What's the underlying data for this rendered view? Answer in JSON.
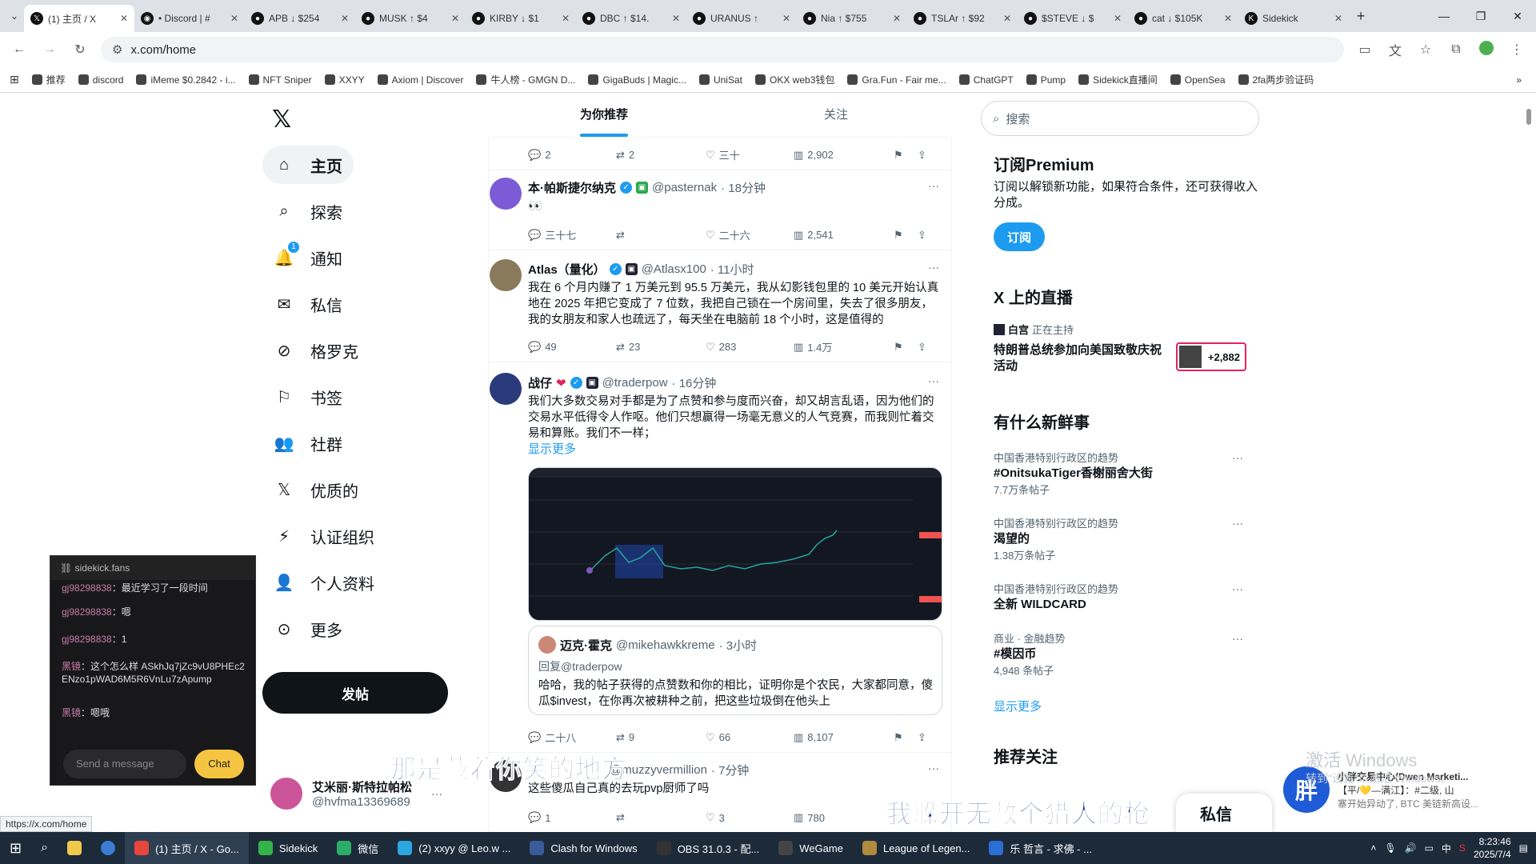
{
  "browser": {
    "tabs": [
      {
        "icon": "x-icon",
        "label": "(1) 主页 / X",
        "active": true
      },
      {
        "icon": "discord-icon",
        "label": "• Discord | #"
      },
      {
        "icon": "token-icon",
        "label": "APB ↓ $254"
      },
      {
        "icon": "token-icon",
        "label": "MUSK ↑ $4"
      },
      {
        "icon": "token-icon",
        "label": "KIRBY ↓ $1"
      },
      {
        "icon": "token-icon",
        "label": "DBC ↑ $14."
      },
      {
        "icon": "token-icon",
        "label": "URANUS ↑"
      },
      {
        "icon": "token-icon",
        "label": "Nia ↑ $755"
      },
      {
        "icon": "token-icon",
        "label": "TSLAr ↑ $92"
      },
      {
        "icon": "token-icon",
        "label": "$STEVE ↓ $"
      },
      {
        "icon": "token-icon",
        "label": "cat ↓ $105K"
      },
      {
        "icon": "sidekick-icon",
        "label": "Sidekick"
      }
    ],
    "url": "x.com/home",
    "bookmarks": [
      "推荐",
      "discord",
      "iMeme $0.2842 - i...",
      "NFT Sniper",
      "XXYY",
      "Axiom | Discover",
      "牛人榜 - GMGN D...",
      "GigaBuds | Magic...",
      "UniSat",
      "OKX web3钱包",
      "Gra.Fun - Fair me...",
      "ChatGPT",
      "Pump",
      "Sidekick直播间",
      "OpenSea",
      "2fa两步验证码"
    ],
    "status_url": "https://x.com/home"
  },
  "nav": {
    "items": [
      {
        "label": "主页",
        "icon": "home-icon"
      },
      {
        "label": "探索",
        "icon": "search-icon"
      },
      {
        "label": "通知",
        "icon": "bell-icon"
      },
      {
        "label": "私信",
        "icon": "mail-icon"
      },
      {
        "label": "格罗克",
        "icon": "grok-icon"
      },
      {
        "label": "书签",
        "icon": "bookmark-icon"
      },
      {
        "label": "社群",
        "icon": "community-icon"
      },
      {
        "label": "优质的",
        "icon": "x-icon"
      },
      {
        "label": "认证组织",
        "icon": "lightning-icon"
      },
      {
        "label": "个人资料",
        "icon": "person-icon"
      },
      {
        "label": "更多",
        "icon": "more-circle-icon"
      }
    ],
    "notif_count": "1",
    "post_label": "发帖",
    "profile_name": "艾米丽·斯特拉帕松",
    "profile_handle": "@hvfma13369689"
  },
  "feed": {
    "tab_for_you": "为你推荐",
    "tab_following": "关注",
    "top_actions": {
      "reply": "2",
      "retweet": "2",
      "like": "三十",
      "views": "2,902"
    },
    "tweets": [
      {
        "name": "本·帕斯捷尔纳克",
        "handle": "@pasternak",
        "time": "· 18分钟",
        "text": "👀",
        "reply": "三十七",
        "retweet": "",
        "like": "二十六",
        "views": "2,541"
      },
      {
        "name": "Atlas（量化）",
        "handle": "@Atlasx100",
        "time": "· 11小时",
        "text": "我在 6 个月内赚了 1 万美元到 95.5 万美元，我从幻影钱包里的 10 美元开始认真地在 2025 年把它变成了 7 位数，我把自己锁在一个房间里，失去了很多朋友，我的女朋友和家人也疏远了，每天坐在电脑前 18 个小时，这是值得的",
        "reply": "49",
        "retweet": "23",
        "like": "283",
        "views": "1.4万"
      },
      {
        "name": "战仔",
        "handle": "@traderpow",
        "time": "· 16分钟",
        "text": "我们大多数交易对手都是为了点赞和参与度而兴奋，却又胡言乱语，因为他们的交易水平低得令人作呕。他们只想赢得一场毫无意义的人气竞赛，而我则忙着交易和算账。我们不一样；",
        "show_more": "显示更多",
        "quote_name": "迈克·霍克",
        "quote_handle": "@mikehawkkreme",
        "quote_time": "· 3小时",
        "quote_reply_to": "回复@traderpow",
        "quote_text": "哈哈，我的帖子获得的点赞数和你的相比，证明你是个农民，大家都同意，傻瓜$invest，在你再次被耕种之前，把这些垃圾倒在他头上",
        "reply": "二十八",
        "retweet": "9",
        "like": "66",
        "views": "8,107"
      },
      {
        "name": "",
        "handle": "@muzzyvermillion",
        "time": "· 7分钟",
        "text": "这些傻瓜自己真的去玩pvp厨师了吗",
        "reply": "1",
        "retweet": "",
        "like": "3",
        "views": "780"
      }
    ]
  },
  "right": {
    "search_placeholder": "搜索",
    "premium_title": "订阅Premium",
    "premium_text": "订阅以解锁新功能，如果符合条件，还可获得收入分成。",
    "premium_btn": "订阅",
    "spaces_title": "X 上的直播",
    "space_host": "白宫",
    "space_status": "正在主持",
    "space_title": "特朗普总统参加向美国致敬庆祝活动",
    "space_count": "+2,882",
    "trends_title": "有什么新鲜事",
    "trends": [
      {
        "cat": "中国香港特别行政区的趋势",
        "name": "#OnitsukaTiger香榭丽舍大街",
        "count": "7.7万条帖子"
      },
      {
        "cat": "中国香港特别行政区的趋势",
        "name": "渴望的",
        "count": "1.38万条帖子"
      },
      {
        "cat": "中国香港特别行政区的趋势",
        "name": "全新 WILDCARD",
        "count": ""
      },
      {
        "cat": "商业 · 金融趋势",
        "name": "#模因币",
        "count": "4,948 条帖子"
      }
    ],
    "show_more": "显示更多",
    "follow_title": "推荐关注",
    "dm_label": "私信"
  },
  "sidekick": {
    "title": "sidekick.fans",
    "messages": [
      {
        "user": "gj98298838",
        "text": "：最近学习了一段时间"
      },
      {
        "user": "gj98298838",
        "text": "：嗯"
      },
      {
        "user": "gj98298838",
        "text": "：1"
      },
      {
        "user": "黑镜",
        "text": "：这个怎么样 ASkhJq7jZc9vU8PHEc2ENzo1pWAD6M5R6VnLu7zApump"
      },
      {
        "user": "黑镜",
        "text": "：嗯哦"
      }
    ],
    "input_placeholder": "Send a message",
    "chat_btn": "Chat"
  },
  "subtitles": {
    "line1": "那是藏着你笑的地方",
    "line2": "我躲开无数个猎人的枪"
  },
  "overlay": {
    "watermark_title": "激活 Windows",
    "watermark_sub": "转到\"设置\"以激活 Windows。",
    "notif_badge": "胖",
    "notif_title": "小胖交易中心(Dwen Marketi...",
    "notif_line1": "【平/💛—满江】：#二级, 山",
    "notif_line2": "寨开始异动了, BTC 美链新高设..."
  },
  "taskbar": {
    "apps": [
      {
        "label": "(1) 主页 / X - Go...",
        "color": "#e8453c",
        "active": true
      },
      {
        "label": "Sidekick",
        "color": "#35b34a"
      },
      {
        "label": "微信",
        "color": "#2aae67"
      },
      {
        "label": "(2) xxyy @ Leo.w ...",
        "color": "#2ca5e0"
      },
      {
        "label": "Clash for Windows",
        "color": "#3a5a9a"
      },
      {
        "label": "OBS 31.0.3 - 配...",
        "color": "#333"
      },
      {
        "label": "WeGame",
        "color": "#444"
      },
      {
        "label": "League of Legen...",
        "color": "#b08a3e"
      },
      {
        "label": "乐 哲言 - 求佛 - ...",
        "color": "#2a6fd6"
      }
    ],
    "time": "8:23:46",
    "date": "2025/7/4",
    "ime": "中"
  },
  "colors": {
    "accent": "#1d9bf0",
    "text": "#0f1419",
    "muted": "#536471"
  }
}
